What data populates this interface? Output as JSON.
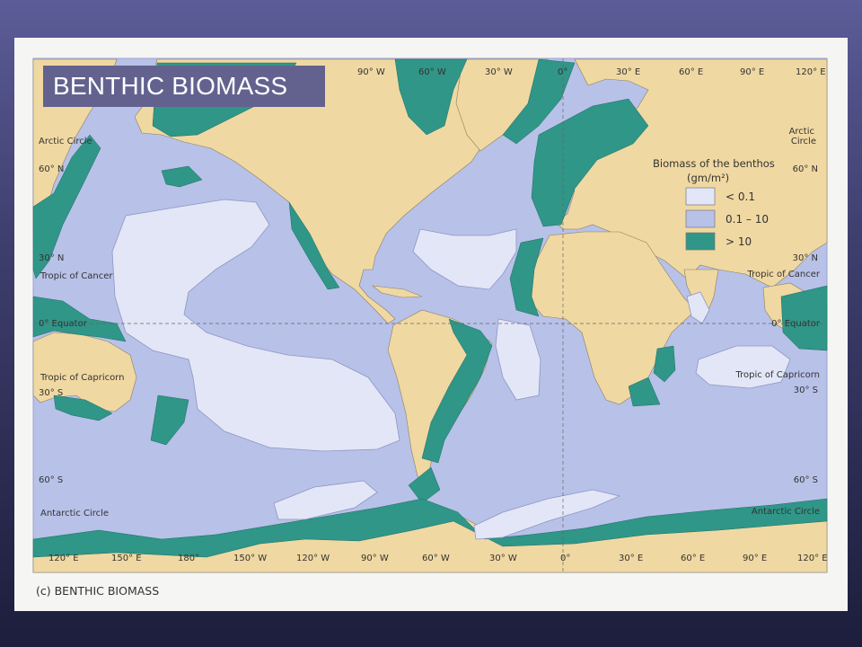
{
  "title": "BENTHIC BIOMASS",
  "caption": "(c) BENTHIC BIOMASS",
  "top_longitudes": [
    "90° W",
    "60° W",
    "30° W",
    "0°",
    "30° E",
    "60° E",
    "90° E",
    "120° E"
  ],
  "bottom_longitudes": [
    "120° E",
    "150° E",
    "180°",
    "150° W",
    "120° W",
    "90° W",
    "60° W",
    "30° W",
    "0°",
    "30° E",
    "60° E",
    "90° E",
    "120° E"
  ],
  "left_latitudes": {
    "arctic_circle": "Arctic Circle",
    "lat60n": "60° N",
    "lat30n": "30° N",
    "tropic_cancer": "Tropic of Cancer",
    "equator": "0° Equator",
    "tropic_capricorn": "Tropic of Capricorn",
    "lat30s": "30° S",
    "lat60s": "60° S",
    "antarctic_circle": "Antarctic Circle"
  },
  "right_latitudes": {
    "arctic_line1": "Arctic",
    "arctic_line2": "Circle",
    "lat60n": "60° N",
    "lat30n": "30° N",
    "tropic_cancer": "Tropic of Cancer",
    "equator": "0° Equator",
    "tropic_capricorn": "Tropic of Capricorn",
    "lat30s": "30° S",
    "lat60s": "60° S",
    "antarctic_circle": "Antarctic Circle"
  },
  "legend": {
    "title_line1": "Biomass of the benthos",
    "title_line2": "(gm/m²)",
    "items": [
      {
        "label": "< 0.1",
        "color": "#e3e6f6"
      },
      {
        "label": "0.1 – 10",
        "color": "#b8c1e8"
      },
      {
        "label": "> 10",
        "color": "#2f9688"
      }
    ]
  },
  "colors": {
    "land": "#f0d8a2",
    "ocean_mid": "#b8c1e8",
    "ocean_low": "#e3e6f6",
    "ocean_high": "#2f9688",
    "title_bg": "#63628f"
  }
}
